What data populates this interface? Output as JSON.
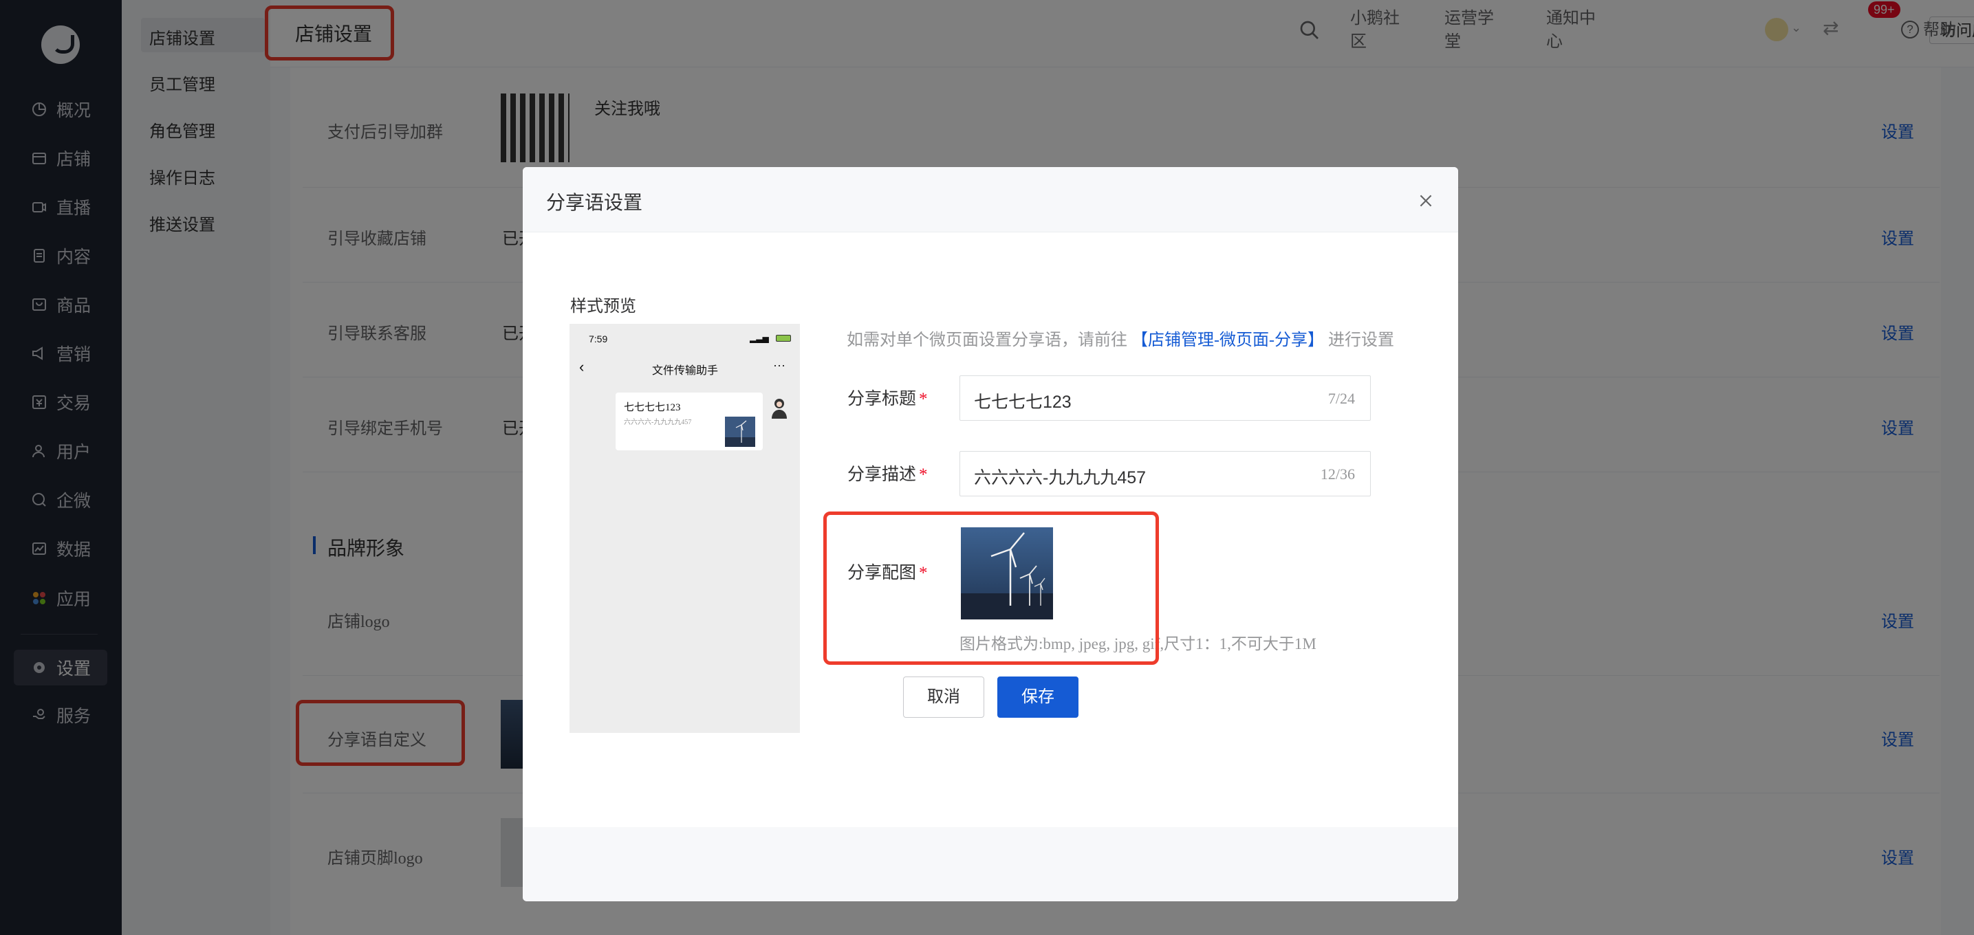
{
  "nav": {
    "items": [
      {
        "label": "概况",
        "icon": "overview-icon"
      },
      {
        "label": "店铺",
        "icon": "store-icon"
      },
      {
        "label": "直播",
        "icon": "live-icon"
      },
      {
        "label": "内容",
        "icon": "content-icon"
      },
      {
        "label": "商品",
        "icon": "goods-icon"
      },
      {
        "label": "营销",
        "icon": "marketing-icon"
      },
      {
        "label": "交易",
        "icon": "trade-icon"
      },
      {
        "label": "用户",
        "icon": "user-icon"
      },
      {
        "label": "企微",
        "icon": "wecom-icon"
      },
      {
        "label": "数据",
        "icon": "data-icon"
      },
      {
        "label": "应用",
        "icon": "apps-icon"
      },
      {
        "label": "设置",
        "icon": "gear-icon"
      },
      {
        "label": "服务",
        "icon": "service-icon"
      }
    ],
    "active": "设置"
  },
  "subnav": {
    "items": [
      "店铺设置",
      "员工管理",
      "角色管理",
      "操作日志",
      "推送设置"
    ],
    "active": "店铺设置"
  },
  "topbar": {
    "title": "店铺设置",
    "community": "小鹅社区",
    "academy": "运营学堂",
    "notify": "通知中心",
    "notify_badge": "99+",
    "visit_store": "访问店铺",
    "help": "帮助"
  },
  "content": {
    "rows": [
      {
        "label": "支付后引导加群",
        "value": "关注我哦",
        "action": "设置"
      },
      {
        "label": "引导收藏店铺",
        "value": "已开",
        "action": "设置"
      },
      {
        "label": "引导联系客服",
        "value": "已开",
        "action": "设置"
      },
      {
        "label": "引导绑定手机号",
        "value": "已开",
        "action": "设置"
      }
    ],
    "brand_section": "品牌形象",
    "brand_rows": [
      {
        "label": "店铺logo",
        "action": "设置"
      },
      {
        "label": "分享语自定义",
        "action": "设置"
      },
      {
        "label": "店铺页脚logo",
        "action": "设置"
      }
    ]
  },
  "modal": {
    "title": "分享语设置",
    "preview_label": "样式预览",
    "phone": {
      "time": "7:59",
      "chat_title": "文件传输助手",
      "card_title": "七七七七123",
      "card_desc": "六六六六-九九九九457"
    },
    "hint_prefix": "如需对单个微页面设置分享语，请前往",
    "hint_link": "【店铺管理-微页面-分享】",
    "hint_suffix": "进行设置",
    "fields": {
      "title_label": "分享标题",
      "title_value": "七七七七123",
      "title_count": "7/24",
      "desc_label": "分享描述",
      "desc_value": "六六六六-九九九九457",
      "desc_count": "12/36",
      "image_label": "分享配图",
      "image_hint": "图片格式为:bmp, jpeg, jpg, gif,尺寸1：1,不可大于1M"
    },
    "required_mark": "*",
    "cancel": "取消",
    "save": "保存"
  },
  "colors": {
    "primary": "#155bd4",
    "highlight": "#ee3c2c",
    "nav_bg": "#1f2430"
  }
}
